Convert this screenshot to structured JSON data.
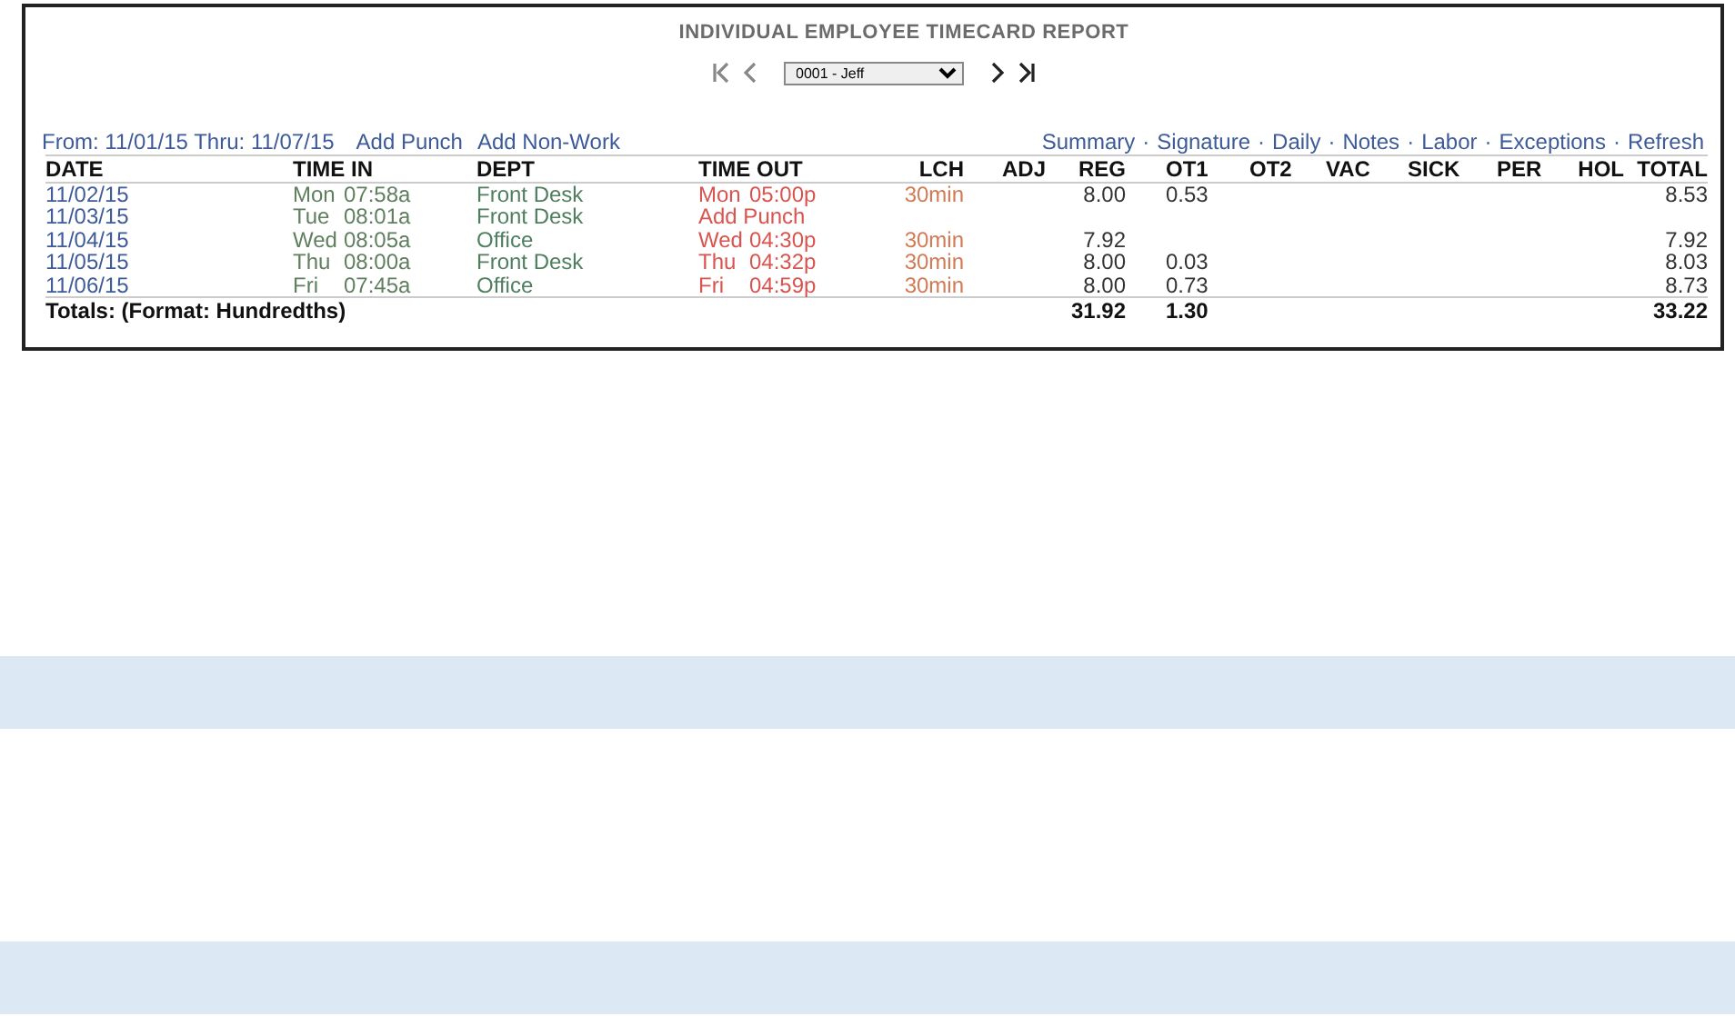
{
  "report": {
    "title": "INDIVIDUAL EMPLOYEE TIMECARD REPORT",
    "employee": "0001 - Jeff",
    "period": "From: 11/01/15 Thru: 11/07/15",
    "actions": [
      "Add Punch",
      "Add Non-Work"
    ],
    "views": [
      "Summary",
      "Signature",
      "Daily",
      "Notes",
      "Labor",
      "Exceptions",
      "Refresh"
    ],
    "separator": "·",
    "columns": [
      "DATE",
      "TIME IN",
      "DEPT",
      "TIME OUT",
      "LCH",
      "ADJ",
      "REG",
      "OT1",
      "OT2",
      "VAC",
      "SICK",
      "PER",
      "HOL",
      "TOTAL"
    ],
    "rows": [
      {
        "date": "11/02/15",
        "in_day": "Mon",
        "in_time": "07:58a",
        "dept": "Front Desk",
        "time_out": {
          "kind": "punch",
          "day": "Mon",
          "time": "05:00p"
        },
        "lch": "30min",
        "reg": "8.00",
        "ot1": "0.53",
        "total": "8.53"
      },
      {
        "date": "11/03/15",
        "in_day": "Tue",
        "in_time": "08:01a",
        "dept": "Front Desk",
        "time_out": {
          "kind": "link",
          "label": "Add Punch"
        }
      },
      {
        "date": "11/04/15",
        "in_day": "Wed",
        "in_time": "08:05a",
        "dept": "Office",
        "time_out": {
          "kind": "punch",
          "day": "Wed",
          "time": "04:30p"
        },
        "lch": "30min",
        "reg": "7.92",
        "total": "7.92"
      },
      {
        "date": "11/05/15",
        "in_day": "Thu",
        "in_time": "08:00a",
        "dept": "Front Desk",
        "time_out": {
          "kind": "punch",
          "day": "Thu",
          "time": "04:32p"
        },
        "lch": "30min",
        "reg": "8.00",
        "ot1": "0.03",
        "total": "8.03"
      },
      {
        "date": "11/06/15",
        "in_day": "Fri",
        "in_time": "07:45a",
        "dept": "Office",
        "time_out": {
          "kind": "punch",
          "day": "Fri",
          "time": "04:59p"
        },
        "lch": "30min",
        "reg": "8.00",
        "ot1": "0.73",
        "total": "8.73"
      }
    ],
    "totals": {
      "label": "Totals: (Format: Hundredths)",
      "reg": "31.92",
      "ot1": "1.30",
      "total": "33.22"
    }
  }
}
